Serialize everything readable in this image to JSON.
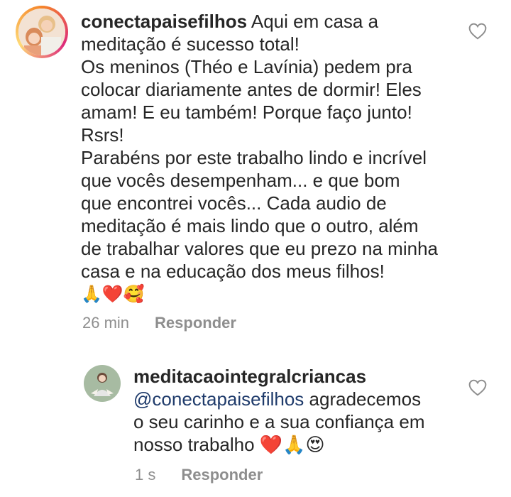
{
  "comments": [
    {
      "username": "conectapaisefilhos",
      "lines": [
        " Aqui em casa a",
        "meditação é sucesso total!",
        "Os meninos (Théo e Lavínia) pedem pra",
        "colocar diariamente antes de dormir! Eles",
        "amam! E eu também! Porque faço junto!",
        "Rsrs!",
        "Parabéns por este trabalho lindo e incrível",
        "que vocês desempenham... e que bom",
        "que encontrei vocês... Cada audio de",
        "meditação é mais lindo que o outro, além",
        "de trabalhar valores que eu prezo na minha",
        "casa e na educação dos meus filhos!",
        "🙏❤️🥰"
      ],
      "time": "26 min",
      "reply_label": "Responder",
      "like_icon": "heart-outline-icon"
    },
    {
      "username": "meditacaointegralcriancas",
      "mention": "@conectapaisefilhos",
      "lines": [
        " agradecemos",
        "o seu carinho e a sua confiança em",
        "nosso trabalho ❤️🙏😍"
      ],
      "time": "1 s",
      "reply_label": "Responder",
      "like_icon": "heart-outline-icon"
    }
  ]
}
